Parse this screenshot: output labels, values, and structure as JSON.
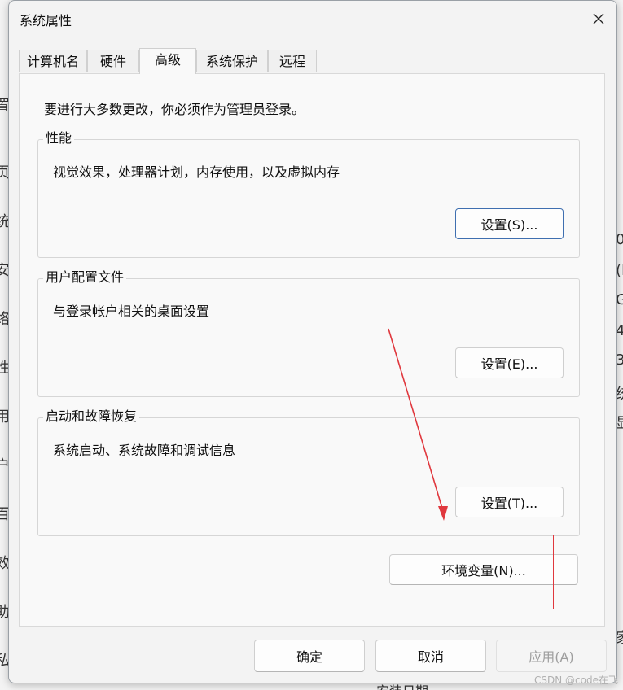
{
  "dialog": {
    "title": "系统属性",
    "close_label": "✕"
  },
  "tabs": [
    {
      "label": "计算机名",
      "active": false
    },
    {
      "label": "硬件",
      "active": false
    },
    {
      "label": "高级",
      "active": true
    },
    {
      "label": "系统保护",
      "active": false
    },
    {
      "label": "远程",
      "active": false
    }
  ],
  "panel": {
    "notice": "要进行大多数更改，你必须作为管理员登录。",
    "performance": {
      "title": "性能",
      "desc": "视觉效果，处理器计划，内存使用，以及虚拟内存",
      "button": "设置(S)..."
    },
    "user_profiles": {
      "title": "用户配置文件",
      "desc": "与登录帐户相关的桌面设置",
      "button": "设置(E)..."
    },
    "startup_recovery": {
      "title": "启动和故障恢复",
      "desc": "系统启动、系统故障和调试信息",
      "button": "设置(T)..."
    },
    "env_button": "环境变量(N)..."
  },
  "footer": {
    "ok": "确定",
    "cancel": "取消",
    "apply": "应用(A)"
  },
  "background": {
    "left_glyphs": [
      "置",
      "页",
      "统",
      "安",
      "络",
      "性",
      "用",
      "户",
      "百",
      "效",
      "助",
      "私"
    ],
    "right_glyphs": [
      "0",
      "(I",
      "GI",
      "4",
      "3",
      "统",
      "显",
      "家"
    ],
    "bottom_text": "安装日期"
  },
  "watermark": "CSDN @code在飞",
  "colors": {
    "annotation": "#e0383e",
    "focus_border": "#3f6fb0"
  }
}
